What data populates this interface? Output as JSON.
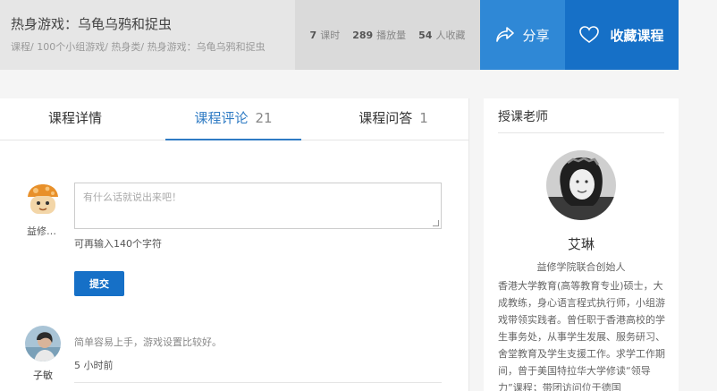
{
  "header": {
    "title": "热身游戏：乌龟乌鸦和捉虫",
    "breadcrumb": "课程/ 100个小组游戏/ 热身类/ 热身游戏：乌龟乌鸦和捉虫",
    "stats": [
      {
        "num": "7",
        "label": "课时"
      },
      {
        "num": "289",
        "label": "播放量"
      },
      {
        "num": "54",
        "label": "人收藏"
      }
    ],
    "share_label": "分享",
    "favorite_label": "收藏课程"
  },
  "tabs": [
    {
      "label": "课程详情",
      "count": ""
    },
    {
      "label": "课程评论",
      "count": "21"
    },
    {
      "label": "课程问答",
      "count": "1"
    }
  ],
  "comment_form": {
    "user_name": "益修…",
    "placeholder": "有什么话就说出来吧！",
    "char_hint": "可再输入140个字符",
    "submit_label": "提交"
  },
  "comments": [
    {
      "user": "子敏",
      "text": "简单容易上手，游戏设置比较好。",
      "time": "5 小时前"
    }
  ],
  "sidebar": {
    "title": "授课老师",
    "teacher_name": "艾琳",
    "teacher_role": "益修学院联合创始人",
    "teacher_bio": "香港大学教育(高等教育专业)硕士，大成教练，身心语言程式执行师，小组游戏带领实践者。曾任职于香港高校的学生事务处，从事学生发展、服务研习、舍堂教育及学生支援工作。求学工作期间，曾于美国特拉华大学修读“领导力”课程；带团访问位于德国"
  },
  "colors": {
    "accent": "#1670c7",
    "share_bg": "#2f88d6",
    "tab_active": "#2f7bc4"
  }
}
